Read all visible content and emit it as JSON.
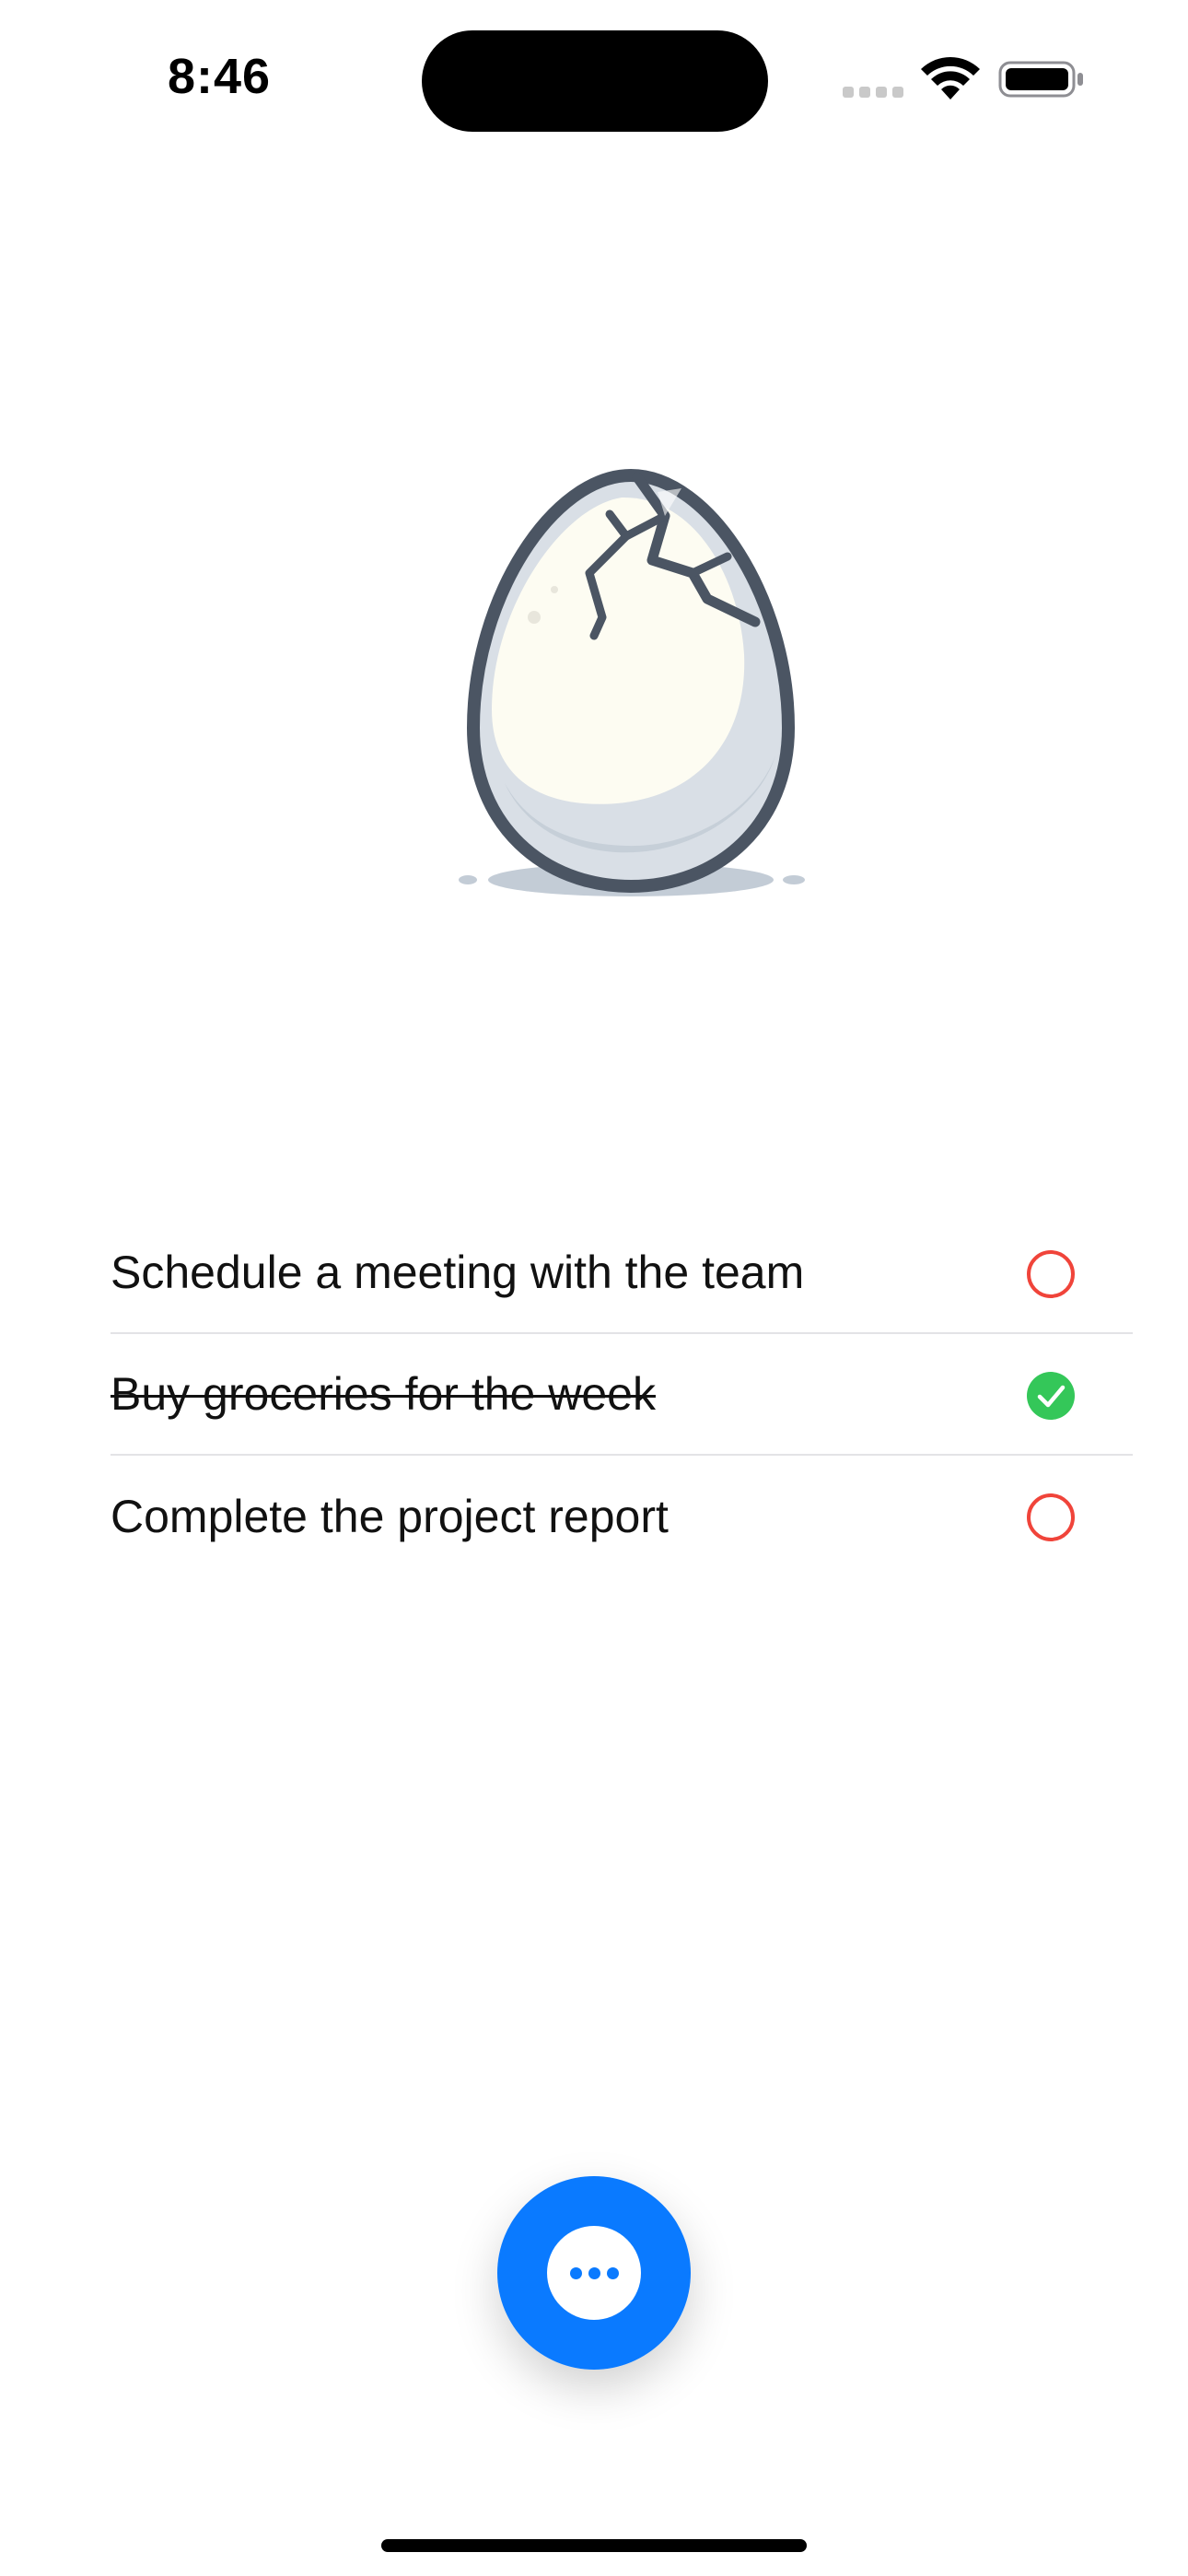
{
  "status_bar": {
    "time": "8:46",
    "icons": [
      "signal-icon",
      "wifi-icon",
      "battery-icon"
    ]
  },
  "illustration": {
    "icon": "cracked-egg-icon"
  },
  "tasks": [
    {
      "label": "Schedule a meeting with the team",
      "completed": false,
      "icon": "empty-circle-icon"
    },
    {
      "label": "Buy groceries for the week",
      "completed": true,
      "icon": "checkmark-circle-icon"
    },
    {
      "label": "Complete the project report",
      "completed": false,
      "icon": "empty-circle-icon"
    }
  ],
  "fab": {
    "icon": "ellipsis-icon"
  },
  "colors": {
    "accent": "#0a7aff",
    "incomplete_ring": "#f0443a",
    "complete_fill": "#34c759",
    "divider": "#e3e3e6"
  }
}
